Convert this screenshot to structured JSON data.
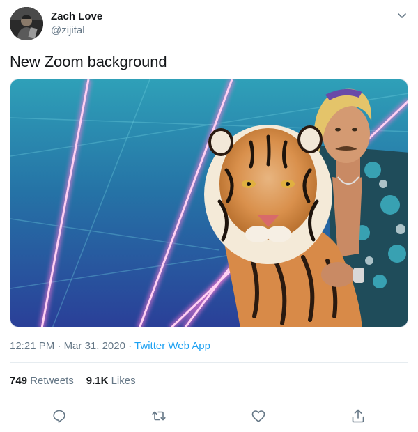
{
  "tweet": {
    "author": {
      "name": "Zach Love",
      "handle": "@zijital",
      "avatar_icon": "profile-photo"
    },
    "text": "New Zoom background",
    "media": {
      "type": "photo",
      "description_icon": "tiger-man-neon-grid-photo"
    },
    "meta": {
      "time": "12:21 PM",
      "separator": "·",
      "date": "Mar 31, 2020",
      "source": "Twitter Web App"
    },
    "stats": {
      "retweets_count": "749",
      "retweets_label": "Retweets",
      "likes_count": "9.1K",
      "likes_label": "Likes"
    },
    "actions": [
      {
        "name": "reply",
        "icon": "reply-icon"
      },
      {
        "name": "retweet",
        "icon": "retweet-icon"
      },
      {
        "name": "like",
        "icon": "heart-icon"
      },
      {
        "name": "share",
        "icon": "share-icon"
      }
    ],
    "colors": {
      "link": "#1da1f2",
      "secondary_text": "#657786",
      "icon": "#657786",
      "divider": "#e6ecf0"
    }
  }
}
